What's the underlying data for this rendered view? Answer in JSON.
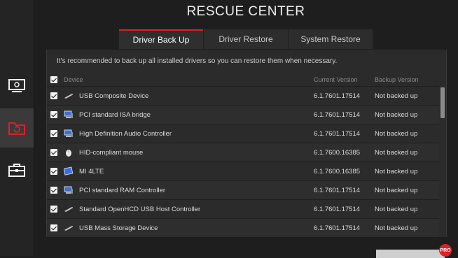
{
  "title": "RESCUE CENTER",
  "tabs": [
    {
      "label": "Driver Back Up",
      "active": true
    },
    {
      "label": "Driver Restore",
      "active": false
    },
    {
      "label": "System Restore",
      "active": false
    }
  ],
  "notice": "It's recommended to back up all installed drivers so you can restore them when necessary.",
  "table": {
    "headers": {
      "device": "Device",
      "current": "Current Version",
      "backup": "Backup Version"
    },
    "rows": [
      {
        "device": "USB Composite Device",
        "current": "6.1.7601.17514",
        "backup": "Not backed up",
        "icon": "usb-plug-icon",
        "checked": true
      },
      {
        "device": "PCI standard ISA bridge",
        "current": "6.1.7601.17514",
        "backup": "Not backed up",
        "icon": "computer-icon",
        "checked": true
      },
      {
        "device": "High Definition Audio Controller",
        "current": "6.1.7601.17514",
        "backup": "Not backed up",
        "icon": "computer-icon",
        "checked": true
      },
      {
        "device": "HID-compliant mouse",
        "current": "6.1.7600.16385",
        "backup": "Not backed up",
        "icon": "mouse-icon",
        "checked": true
      },
      {
        "device": "MI 4LTE",
        "current": "6.1.7600.16385",
        "backup": "Not backed up",
        "icon": "phone-icon",
        "checked": true
      },
      {
        "device": "PCI standard RAM Controller",
        "current": "6.1.7601.17514",
        "backup": "Not backed up",
        "icon": "computer-icon",
        "checked": true
      },
      {
        "device": "Standard OpenHCD USB Host Controller",
        "current": "6.1.7601.17514",
        "backup": "Not backed up",
        "icon": "usb-plug-icon",
        "checked": true
      },
      {
        "device": "USB Mass Storage Device",
        "current": "6.1.7601.17514",
        "backup": "Not backed up",
        "icon": "usb-plug-icon",
        "checked": true
      }
    ]
  },
  "sidebar": {
    "items": [
      "monitor-icon",
      "restore-folder-icon",
      "toolbox-icon"
    ],
    "active_index": 1
  },
  "badge": "PRO",
  "colors": {
    "accent": "#e01f26",
    "background": "#1e1e1e",
    "panel": "#2b2b2b"
  }
}
